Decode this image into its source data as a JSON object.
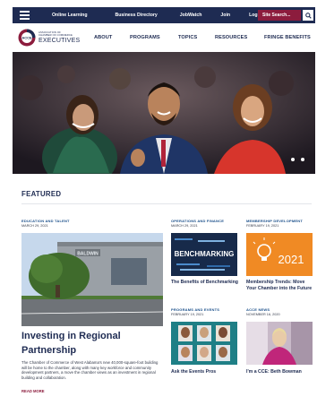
{
  "topbar": {
    "links": [
      "Online Learning",
      "Business Directory",
      "JobWatch",
      "Join",
      "Login"
    ],
    "search_placeholder": "Site Search..."
  },
  "logo": {
    "line1": "ASSOCIATION OF",
    "line2": "CHAMBER OF COMMERCE",
    "name": "EXECUTIVES",
    "mark_text": "ACCE"
  },
  "nav": {
    "items": [
      "ABOUT",
      "PROGRAMS",
      "TOPICS",
      "RESOURCES",
      "FRINGE BENEFITS"
    ]
  },
  "hero": {
    "slide_count": 2
  },
  "featured": {
    "heading": "FEATURED",
    "main": {
      "category": "EDUCATION AND TALENT",
      "date": "MARCH 29, 2021",
      "building_sign": "BALDWIN",
      "title": "Investing in Regional Partnership",
      "description": "The Chamber of Commerce of West Alabama's new 40,000-square-foot building will be home to the chamber, along with many key workforce and community development partners, a move the chamber views as an investment in regional building and collaboration.",
      "read_more": "READ MORE"
    },
    "cards": [
      {
        "category": "OPERATIONS AND FINANCE",
        "date": "MARCH 29, 2021",
        "image_text": "BENCHMARKING",
        "title": "The Benefits of Benchmarking"
      },
      {
        "category": "MEMBERSHIP DEVELOPMENT",
        "date": "FEBRUARY 19, 2021",
        "image_text": "2021",
        "title": "Membership Trends: Move Your Chamber into the Future"
      },
      {
        "category": "PROGRAMS AND EVENTS",
        "date": "FEBRUARY 19, 2021",
        "title": "Ask the Events Pros"
      },
      {
        "category": "ACCE NEWS",
        "date": "NOVEMBER 16, 2020",
        "title": "I'm a CCE: Beth Bowman"
      }
    ]
  },
  "colors": {
    "navy": "#1e2b52",
    "maroon": "#8c1c3d",
    "link_blue": "#1a4f8a",
    "orange": "#f08a24"
  }
}
